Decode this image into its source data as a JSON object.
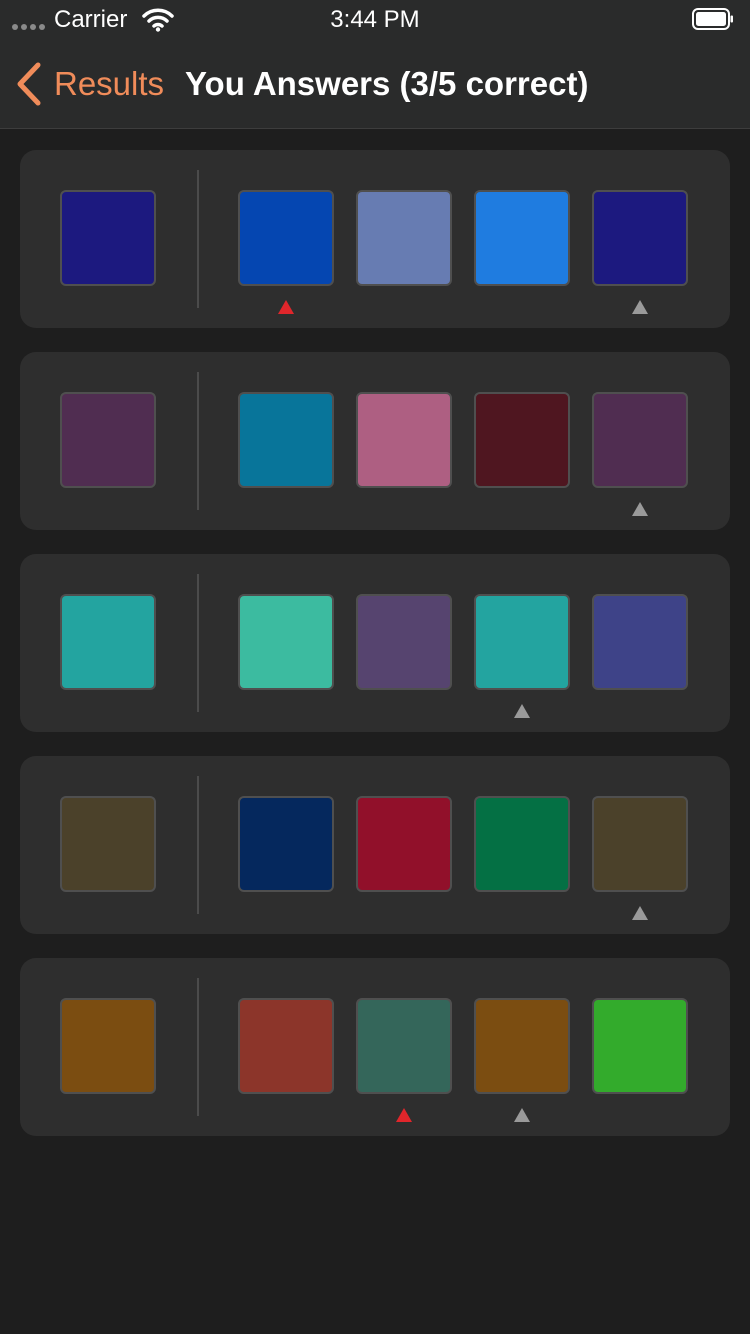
{
  "status_bar": {
    "carrier": "Carrier",
    "time": "3:44 PM",
    "icons": [
      "signal-icon",
      "wifi-icon",
      "battery-icon"
    ]
  },
  "nav": {
    "back_label": "Results",
    "back_icon": "chevron-left-icon",
    "title": "You Answers (3/5 correct)"
  },
  "colors": {
    "accent": "#f08c5a",
    "background": "#1e1e1e",
    "card": "#2e2e2e",
    "wrong_marker": "#e0262b",
    "correct_marker": "#9a9a9a"
  },
  "questions": [
    {
      "target": "#1c197f",
      "options": [
        "#0546b1",
        "#677cb2",
        "#1f7ce0",
        "#1c197f"
      ],
      "selected": 0,
      "correct": 3
    },
    {
      "target": "#502d51",
      "options": [
        "#08759a",
        "#ae5f82",
        "#4f1620",
        "#502d51"
      ],
      "selected": 3,
      "correct": 3
    },
    {
      "target": "#23a4a0",
      "options": [
        "#3cbba0",
        "#56446f",
        "#23a4a0",
        "#3e4388"
      ],
      "selected": 2,
      "correct": 2
    },
    {
      "target": "#4b412a",
      "options": [
        "#05285d",
        "#91102a",
        "#047044",
        "#4b412a"
      ],
      "selected": 3,
      "correct": 3
    },
    {
      "target": "#7b4d11",
      "options": [
        "#8c352a",
        "#34665a",
        "#7b4d11",
        "#33ab2c"
      ],
      "selected": 1,
      "correct": 2
    }
  ]
}
